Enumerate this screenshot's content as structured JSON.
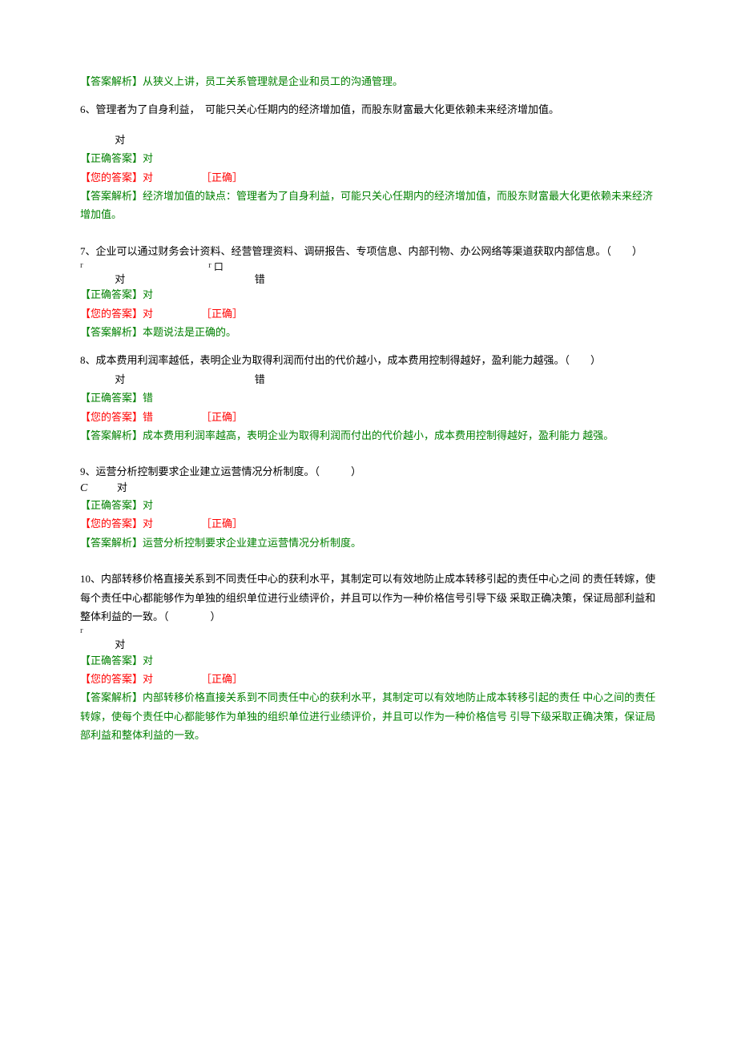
{
  "q5_analysis_label": "【答案解析】",
  "q5_analysis_text": "从狭义上讲，员工关系管理就是企业和员工的沟通管理。",
  "q6": {
    "text": "6、管理者为了自身利益，　可能只关心任期内的经济增加值，而股东财富最大化更依赖未来经济增加值。",
    "opt_true": "对",
    "correct_label": "【正确答案】",
    "correct_val": "对",
    "your_label": "【您的答案】",
    "your_val": "对",
    "result_flag": "［正确］",
    "analysis_label": "【答案解析】",
    "analysis_text": "经济增加值的缺点：管理者为了自身利益，可能只关心任期内的经济增加值，而股东财富最大化更依赖未来经济增加值。"
  },
  "q7": {
    "text": "7、企业可以通过财务会计资料、经营管理资料、调研报告、专项信息、内部刊物、办公网络等渠道获取内部信息。（　　）",
    "opt_true": "对",
    "opt_false": "错",
    "correct_label": "【正确答案】",
    "correct_val": "对",
    "your_label": "【您的答案】",
    "your_val": "对",
    "result_flag": "［正确］",
    "analysis_label": "【答案解析】",
    "analysis_text": "本题说法是正确的。"
  },
  "q8": {
    "text": "8、成本费用利润率越低，表明企业为取得利润而付出的代价越小，成本费用控制得越好，盈利能力越强。（　　）",
    "opt_true": "对",
    "opt_false": "错",
    "correct_label": "【正确答案】",
    "correct_val": "错",
    "your_label": "【您的答案】",
    "your_val": "错",
    "result_flag": "［正确］",
    "analysis_label": "【答案解析】",
    "analysis_text": "成本费用利润率越高，表明企业为取得利润而付出的代价越小，成本费用控制得越好，盈利能力 越强。"
  },
  "q9": {
    "text": "9、运营分析控制要求企业建立运营情况分析制度。（　　　）",
    "opt_true": "对",
    "correct_label": "【正确答案】",
    "correct_val": "对",
    "your_label": "【您的答案】",
    "your_val": "对",
    "result_flag": "［正确］",
    "analysis_label": "【答案解析】",
    "analysis_text": "运营分析控制要求企业建立运营情况分析制度。"
  },
  "q10": {
    "text": "10、内部转移价格直接关系到不同责任中心的获利水平，其制定可以有效地防止成本转移引起的责任中心之间 的责任转嫁，使每个责任中心都能够作为单独的组织单位进行业绩评价，并且可以作为一种价格信号引导下级 采取正确决策，保证局部利益和整体利益的一致。（　　　　）",
    "opt_true": "对",
    "correct_label": "【正确答案】",
    "correct_val": "对",
    "your_label": "【您的答案】",
    "your_val": "对",
    "result_flag": "［正确］",
    "analysis_label": "【答案解析】",
    "analysis_text": "内部转移价格直接关系到不同责任中心的获利水平，其制定可以有效地防止成本转移引起的责任 中心之间的责任转嫁，使每个责任中心都能够作为单独的组织单位进行业绩评价，并且可以作为一种价格信号 引导下级采取正确决策，保证局部利益和整体利益的一致。"
  }
}
